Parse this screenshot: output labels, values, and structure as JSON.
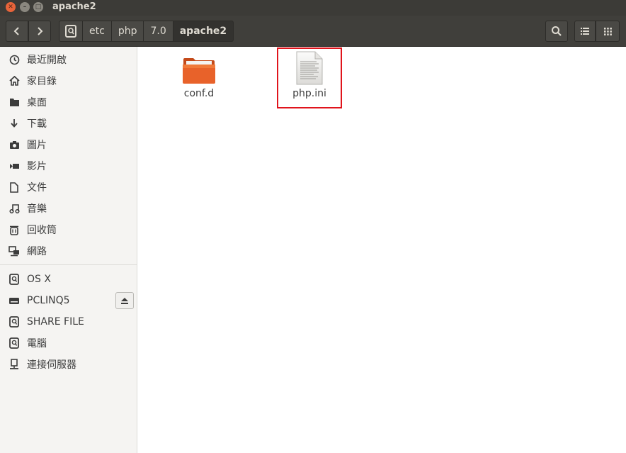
{
  "window": {
    "title": "apache2"
  },
  "toolbar": {
    "breadcrumbs": [
      "etc",
      "php",
      "7.0",
      "apache2"
    ]
  },
  "sidebar": {
    "places": [
      {
        "label": "最近開啟",
        "icon": "clock-icon"
      },
      {
        "label": "家目錄",
        "icon": "home-icon"
      },
      {
        "label": "桌面",
        "icon": "folder-icon"
      },
      {
        "label": "下載",
        "icon": "download-icon"
      },
      {
        "label": "圖片",
        "icon": "camera-icon"
      },
      {
        "label": "影片",
        "icon": "video-icon"
      },
      {
        "label": "文件",
        "icon": "document-icon"
      },
      {
        "label": "音樂",
        "icon": "music-icon"
      },
      {
        "label": "回收筒",
        "icon": "trash-icon"
      },
      {
        "label": "網路",
        "icon": "network-icon"
      }
    ],
    "devices": [
      {
        "label": "OS X",
        "icon": "drive-icon"
      },
      {
        "label": "PCLINQ5",
        "icon": "removable-drive-icon"
      },
      {
        "label": "SHARE FILE",
        "icon": "drive-icon"
      },
      {
        "label": "電腦",
        "icon": "drive-icon"
      },
      {
        "label": "連接伺服器",
        "icon": "server-icon"
      }
    ]
  },
  "files": [
    {
      "name": "conf.d",
      "type": "folder"
    },
    {
      "name": "php.ini",
      "type": "text-file",
      "highlighted": true
    }
  ],
  "colors": {
    "titlebar": "#3c3b37",
    "folder": "#e8622a",
    "highlight": "#e0141c"
  }
}
